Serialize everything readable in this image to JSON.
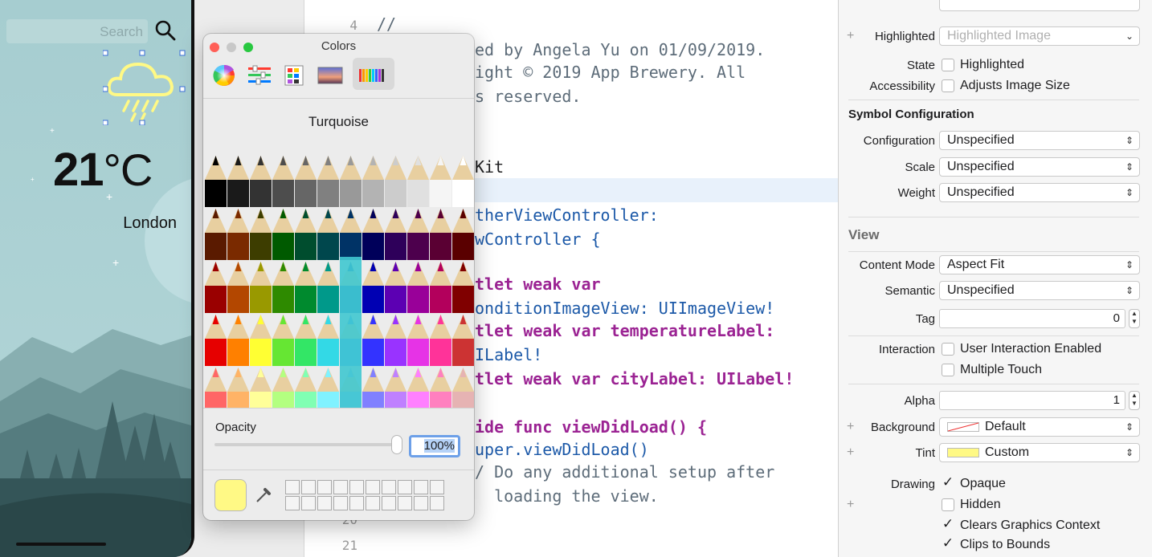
{
  "phone": {
    "search_placeholder": "Search",
    "temperature_value": "21",
    "temperature_unit": "°C",
    "city": "London"
  },
  "editor": {
    "line_numbers": [
      "4",
      "20",
      "21"
    ],
    "comment_lead": "//",
    "lines": [
      [
        "ed by Angela Yu on 01/09/2019."
      ],
      [
        "ight © 2019 App Brewery. All"
      ],
      [
        "s reserved."
      ],
      [
        "Kit"
      ],
      [
        "therViewController:"
      ],
      [
        "wController {"
      ],
      [
        "tlet weak var"
      ],
      [
        "onditionImageView: UIImageView!"
      ],
      [
        "tlet weak var temperatureLabel:"
      ],
      [
        "ILabel!"
      ],
      [
        "tlet weak var cityLabel: UILabel!"
      ],
      [
        "ide func viewDidLoad() {"
      ],
      [
        "uper.viewDidLoad()"
      ],
      [
        "/ Do any additional setup after"
      ],
      [
        "  loading the view."
      ]
    ]
  },
  "colors_panel": {
    "title": "Colors",
    "modes": [
      "color-wheel",
      "color-sliders",
      "color-palettes",
      "image-palettes",
      "pencils"
    ],
    "palette_name": "Turquoise",
    "opacity_label": "Opacity",
    "opacity_value": "100%",
    "opacity_level": 1.0,
    "current_color": "#fff985"
  },
  "inspector": {
    "highlighted_label": "Highlighted",
    "highlighted_placeholder": "Highlighted Image",
    "state_label": "State",
    "state_option": "Highlighted",
    "accessibility_label": "Accessibility",
    "accessibility_option": "Adjusts Image Size",
    "symbol_config_header": "Symbol Configuration",
    "configuration_label": "Configuration",
    "configuration_value": "Unspecified",
    "scale_label": "Scale",
    "scale_value": "Unspecified",
    "weight_label": "Weight",
    "weight_value": "Unspecified",
    "view_header": "View",
    "content_mode_label": "Content Mode",
    "content_mode_value": "Aspect Fit",
    "semantic_label": "Semantic",
    "semantic_value": "Unspecified",
    "tag_label": "Tag",
    "tag_value": "0",
    "interaction_label": "Interaction",
    "user_interaction_option": "User Interaction Enabled",
    "multiple_touch_option": "Multiple Touch",
    "alpha_label": "Alpha",
    "alpha_value": "1",
    "background_label": "Background",
    "background_value": "Default",
    "tint_label": "Tint",
    "tint_value": "Custom",
    "tint_color": "#fff985",
    "drawing_label": "Drawing",
    "opaque_option": "Opaque",
    "hidden_option": "Hidden",
    "clears_option": "Clears Graphics Context",
    "clips_option": "Clips to Bounds"
  }
}
